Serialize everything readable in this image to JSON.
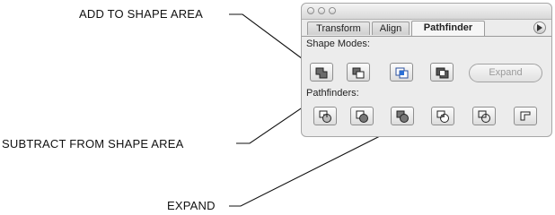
{
  "callouts": {
    "add": "ADD TO SHAPE AREA",
    "subtract": "SUBTRACT FROM SHAPE AREA",
    "expand": "EXPAND"
  },
  "tabs": [
    "Transform",
    "Align",
    "Pathfinder"
  ],
  "active_tab": "Pathfinder",
  "shape_modes": {
    "label": "Shape Modes:",
    "buttons": [
      "add-to-shape-area-icon",
      "subtract-from-shape-area-icon",
      "intersect-shape-areas-icon",
      "exclude-overlapping-areas-icon"
    ],
    "expand_label": "Expand"
  },
  "pathfinders": {
    "label": "Pathfinders:",
    "buttons": [
      "divide-icon",
      "trim-icon",
      "merge-icon",
      "crop-icon",
      "outline-icon",
      "minus-back-icon"
    ]
  }
}
